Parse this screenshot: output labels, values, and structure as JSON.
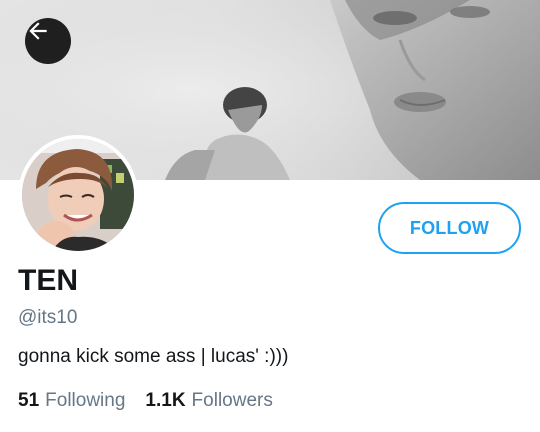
{
  "profile": {
    "display_name": "TEN",
    "handle": "@its10",
    "bio": "gonna kick some ass | lucas' :)))",
    "follow_label": "FOLLOW",
    "following_count": "51",
    "following_label": "Following",
    "followers_count": "1.1K",
    "followers_label": "Followers"
  },
  "icons": {
    "back": "arrow-left-icon"
  },
  "colors": {
    "accent": "#1da1f2",
    "text_primary": "#14171a",
    "text_secondary": "#657786",
    "back_button_bg": "#1f1f1f"
  }
}
